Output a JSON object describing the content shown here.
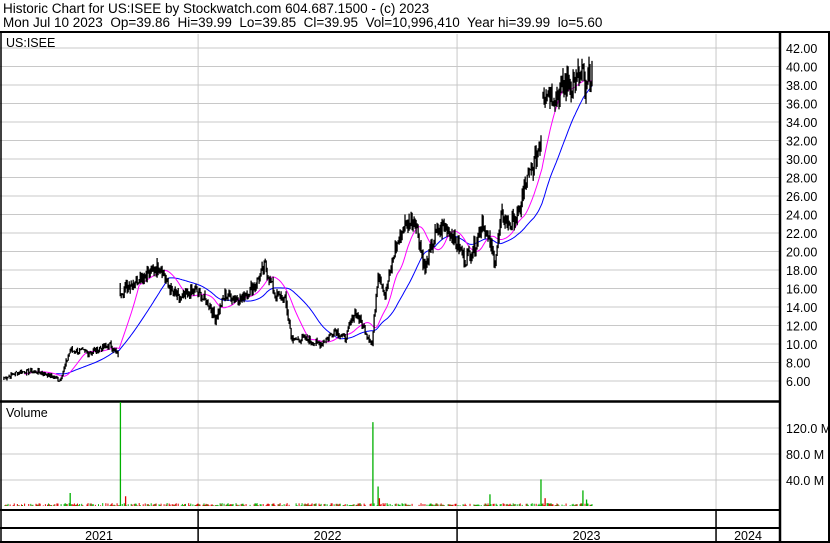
{
  "header": {
    "line1": "Historic Chart for US:ISEE by Stockwatch.com 604.687.1500 - (c) 2023",
    "line2": "Mon Jul 10 2023  Op=39.86  Hi=39.99  Lo=39.85  Cl=39.95  Vol=10,996,410  Year hi=39.99  lo=5.60"
  },
  "colors": {
    "price": "#000000",
    "ma_short": "#ff00ff",
    "ma_long": "#0000ff",
    "vol_up": "#00b000",
    "vol_down": "#e00000",
    "grid": "#c8c8c8"
  },
  "chart_data": [
    {
      "type": "line",
      "title": "US:ISEE",
      "price_ticks": [
        "42.00",
        "40.00",
        "38.00",
        "36.00",
        "34.00",
        "32.00",
        "30.00",
        "28.00",
        "26.00",
        "24.00",
        "22.00",
        "20.00",
        "18.00",
        "16.00",
        "14.00",
        "12.00",
        "10.00",
        "8.00",
        "6.00"
      ],
      "ylim": [
        5.0,
        43.0
      ],
      "xlim": [
        2021.235,
        2024.247
      ],
      "x_tick_labels": [
        {
          "label": "2021",
          "year": 2021
        },
        {
          "label": "2022",
          "year": 2022
        },
        {
          "label": "2023",
          "year": 2023
        },
        {
          "label": "2024",
          "year": 2024
        }
      ],
      "series": [
        {
          "name": "price",
          "points": [
            [
              2021.25,
              6.3
            ],
            [
              2021.31,
              7.0
            ],
            [
              2021.39,
              7.0
            ],
            [
              2021.467,
              6.1
            ],
            [
              2021.506,
              9.3
            ],
            [
              2021.583,
              9.1
            ],
            [
              2021.66,
              9.9
            ],
            [
              2021.691,
              8.8
            ],
            [
              2021.707,
              15.8
            ],
            [
              2021.757,
              16.9
            ],
            [
              2021.815,
              17.8
            ],
            [
              2021.853,
              18.5
            ],
            [
              2021.892,
              15.8
            ],
            [
              2021.931,
              14.8
            ],
            [
              2021.988,
              15.8
            ],
            [
              2022.046,
              14.2
            ],
            [
              2022.066,
              12.6
            ],
            [
              2022.104,
              15.3
            ],
            [
              2022.162,
              14.8
            ],
            [
              2022.22,
              16.4
            ],
            [
              2022.259,
              18.5
            ],
            [
              2022.297,
              15.3
            ],
            [
              2022.336,
              14.8
            ],
            [
              2022.363,
              10.4
            ],
            [
              2022.413,
              10.6
            ],
            [
              2022.471,
              9.9
            ],
            [
              2022.529,
              11.5
            ],
            [
              2022.568,
              10.6
            ],
            [
              2022.606,
              13.5
            ],
            [
              2022.645,
              11.5
            ],
            [
              2022.672,
              9.9
            ],
            [
              2022.695,
              18.0
            ],
            [
              2022.722,
              15.3
            ],
            [
              2022.761,
              20.2
            ],
            [
              2022.799,
              22.9
            ],
            [
              2022.838,
              23.4
            ],
            [
              2022.876,
              18.0
            ],
            [
              2022.915,
              21.8
            ],
            [
              2022.954,
              22.9
            ],
            [
              2022.992,
              21.2
            ],
            [
              2023.031,
              19.1
            ],
            [
              2023.069,
              20.7
            ],
            [
              2023.097,
              23.4
            ],
            [
              2023.127,
              20.7
            ],
            [
              2023.147,
              19.1
            ],
            [
              2023.174,
              23.9
            ],
            [
              2023.205,
              22.9
            ],
            [
              2023.236,
              23.9
            ],
            [
              2023.263,
              27.2
            ],
            [
              2023.29,
              28.8
            ],
            [
              2023.313,
              31.0
            ],
            [
              2023.324,
              32.6
            ],
            [
              2023.34,
              37.5
            ],
            [
              2023.378,
              36.9
            ],
            [
              2023.417,
              38.0
            ],
            [
              2023.456,
              38.5
            ],
            [
              2023.486,
              39.1
            ],
            [
              2023.494,
              36.9
            ],
            [
              2023.521,
              39.95
            ]
          ]
        }
      ]
    },
    {
      "type": "bar",
      "title": "Volume",
      "unit": "M",
      "volume_ticks": [
        "120.0 M",
        "80.0 M",
        "40.0 M"
      ],
      "ylim": [
        0,
        160
      ],
      "typical_volume_m": 3,
      "spikes": [
        [
          2021.506,
          20
        ],
        [
          2021.7,
          160
        ],
        [
          2021.72,
          15
        ],
        [
          2022.675,
          129
        ],
        [
          2022.695,
          30
        ],
        [
          2022.7,
          12
        ],
        [
          2023.127,
          18
        ],
        [
          2023.324,
          41
        ],
        [
          2023.34,
          12
        ],
        [
          2023.486,
          24
        ],
        [
          2023.5,
          10
        ]
      ]
    }
  ]
}
